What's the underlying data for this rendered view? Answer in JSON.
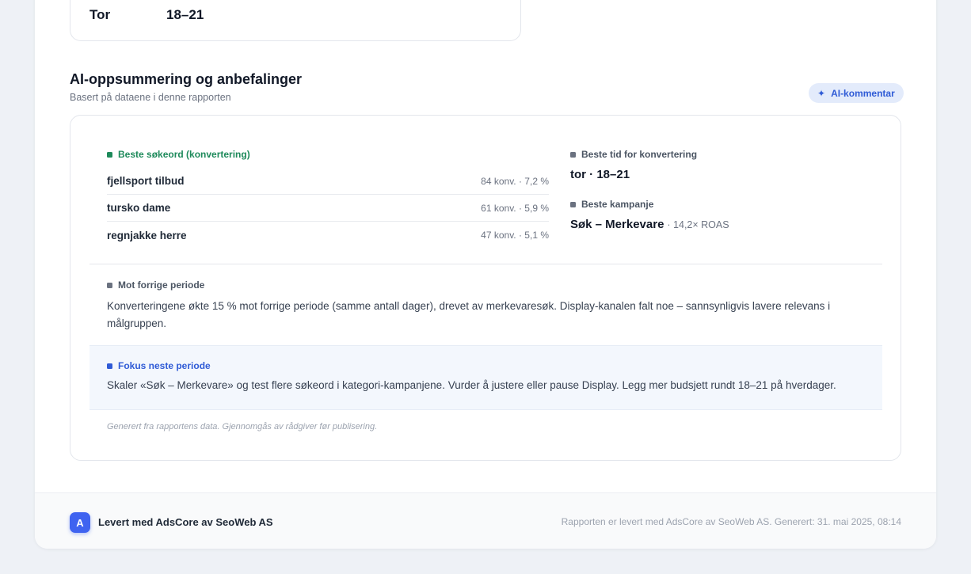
{
  "schedule": {
    "day": "Tor",
    "hours": "18–21"
  },
  "ai_section": {
    "title": "AI-oppsummering og anbefalinger",
    "subtitle": "Basert på dataene i denne rapporten",
    "button_label": "AI-kommentar",
    "button_icon": "sparkle-icon"
  },
  "best_keywords": {
    "label": "Beste søkeord (konvertering)",
    "items": [
      {
        "name": "fjellsport tilbud",
        "stat": "84 konv. · 7,2 %"
      },
      {
        "name": "tursko dame",
        "stat": "61 konv. · 5,9 %"
      },
      {
        "name": "regnjakke herre",
        "stat": "47 konv. · 5,1 %"
      }
    ]
  },
  "best_time": {
    "label": "Beste tid for konvertering",
    "value": "tor · 18–21"
  },
  "best_campaign": {
    "label": "Beste kampanje",
    "name": "Søk – Merkevare",
    "roas": "· 14,2× ROAS"
  },
  "previous_period": {
    "label": "Mot forrige periode",
    "text": "Konverteringene økte 15 % mot forrige periode (samme antall dager), drevet av merkevaresøk. Display-kanalen falt noe – sannsynligvis lavere relevans i målgruppen."
  },
  "focus": {
    "label": "Fokus neste periode",
    "text": "Skaler «Søk – Merkevare» og test flere søkeord i kategori-kampanjene. Vurder å justere eller pause Display. Legg mer budsjett rundt 18–21 på hverdager."
  },
  "generated_note": "Generert fra rapportens data. Gjennomgås av rådgiver før publisering.",
  "footer": {
    "logo_letter": "A",
    "brand": "Levert med AdsCore av SeoWeb AS",
    "note": "Rapporten er levert med AdsCore av SeoWeb AS. Generert: 31. mai 2025, 08:14"
  },
  "colors": {
    "accent": "#2f5bd6",
    "success": "#1e8a5b",
    "logo": "#3f63f0",
    "focus_bg": "#f3f7fd"
  }
}
